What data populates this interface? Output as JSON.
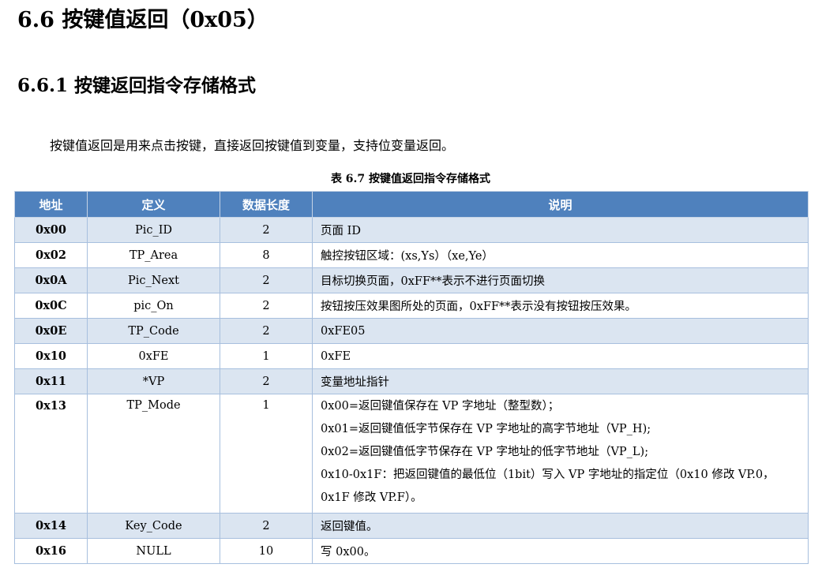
{
  "heading1": "6.6 按键值返回（0x05）",
  "heading2": "6.6.1  按键返回指令存储格式",
  "intro": "按键值返回是用来点击按键，直接返回按键值到变量，支持位变量返回。",
  "caption": "表 6.7 按键值返回指令存储格式",
  "colors": {
    "header_bg": "#4f81bd",
    "band_bg": "#dbe5f1",
    "border": "#a7bfde"
  },
  "table": {
    "headers": [
      "地址",
      "定义",
      "数据长度",
      "说明"
    ],
    "rows": [
      {
        "addr": "0x00",
        "def": "Pic_ID",
        "len": "2",
        "desc": [
          "页面 ID"
        ]
      },
      {
        "addr": "0x02",
        "def": "TP_Area",
        "len": "8",
        "desc": [
          "触控按钮区域：(xs,Ys）（xe,Ye）"
        ]
      },
      {
        "addr": "0x0A",
        "def": "Pic_Next",
        "len": "2",
        "desc": [
          "目标切换页面，0xFF**表示不进行页面切换"
        ]
      },
      {
        "addr": "0x0C",
        "def": "pic_On",
        "len": "2",
        "desc": [
          "按钮按压效果图所处的页面，0xFF**表示没有按钮按压效果。"
        ]
      },
      {
        "addr": "0x0E",
        "def": "TP_Code",
        "len": "2",
        "desc": [
          "0xFE05"
        ]
      },
      {
        "addr": "0x10",
        "def": "0xFE",
        "len": "1",
        "desc": [
          "0xFE"
        ]
      },
      {
        "addr": "0x11",
        "def": "*VP",
        "len": "2",
        "desc": [
          "变量地址指针"
        ]
      },
      {
        "addr": "0x13",
        "def": "TP_Mode",
        "len": "1",
        "desc": [
          "0x00=返回键值保存在 VP 字地址（整型数）；",
          "0x01=返回键值低字节保存在 VP 字地址的高字节地址（VP_H);",
          "0x02=返回键值低字节保存在 VP 字地址的低字节地址（VP_L);",
          "0x10-0x1F：把返回键值的最低位（1bit）写入 VP 字地址的指定位（0x10 修改 VP.0，",
          "0x1F 修改 VP.F）。"
        ]
      },
      {
        "addr": "0x14",
        "def": "Key_Code",
        "len": "2",
        "desc": [
          "返回键值。"
        ]
      },
      {
        "addr": "0x16",
        "def": "NULL",
        "len": "10",
        "desc": [
          "写 0x00。"
        ]
      }
    ]
  }
}
